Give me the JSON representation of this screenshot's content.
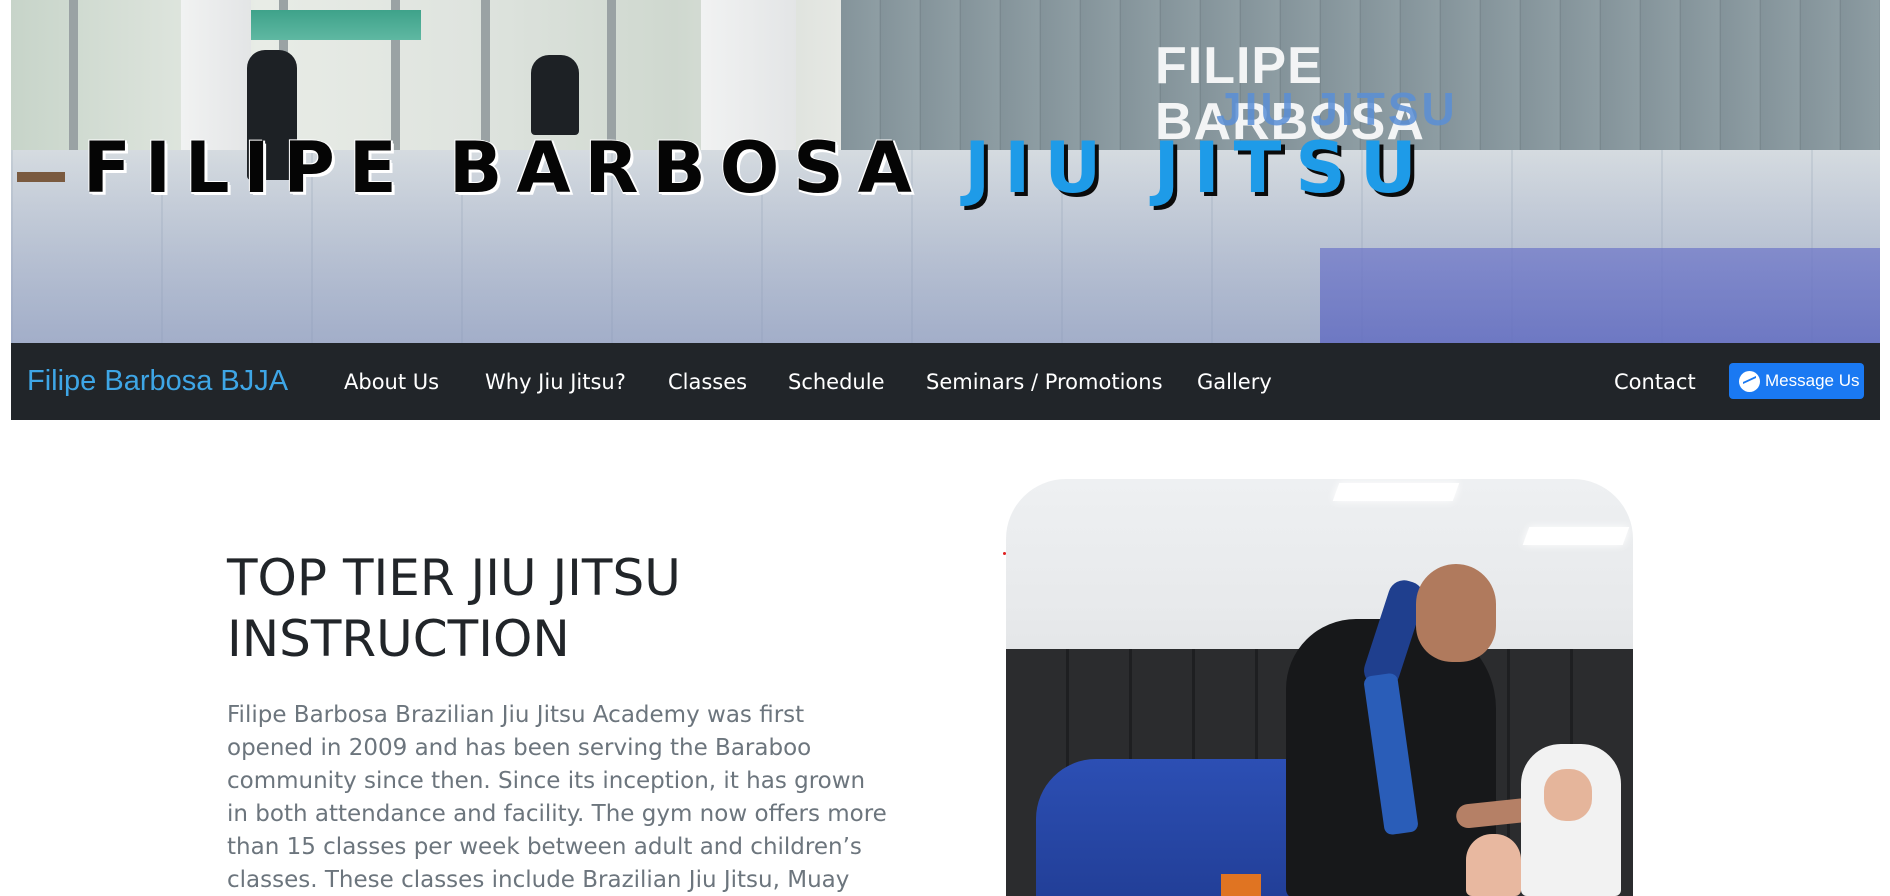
{
  "hero": {
    "title_part_black": "FILIPE BARBOSA",
    "title_part_blue": "JIU JITSU",
    "wall_logo_main": "FILIPE BARBOSA",
    "wall_logo_sub": "JIU JITSU",
    "title_colors": {
      "black": "#050505",
      "blue": "#1e9be8"
    }
  },
  "navbar": {
    "brand": "Filipe Barbosa BJJA",
    "items": [
      {
        "label": "About Us"
      },
      {
        "label": "Why Jiu Jitsu?"
      },
      {
        "label": "Classes"
      },
      {
        "label": "Schedule"
      },
      {
        "label": "Seminars / Promotions"
      },
      {
        "label": "Gallery"
      }
    ],
    "contact": "Contact",
    "messenger_button": "Message Us",
    "messenger_icon": "messenger-icon",
    "colors": {
      "background": "#212529",
      "brand": "#3ea6e6",
      "messenger": "#1a79f2"
    }
  },
  "main": {
    "heading_line1": "TOP TIER JIU JITSU",
    "heading_line2": "INSTRUCTION",
    "body": "Filipe Barbosa Brazilian Jiu Jitsu Academy was first opened in 2009 and has been serving the Baraboo community since then. Since its inception, it has grown in both attendance and facility. The gym now offers more than 15 classes per week between adult and children’s classes. These classes include Brazilian Jiu Jitsu, Muay Thai, and Cardio"
  }
}
